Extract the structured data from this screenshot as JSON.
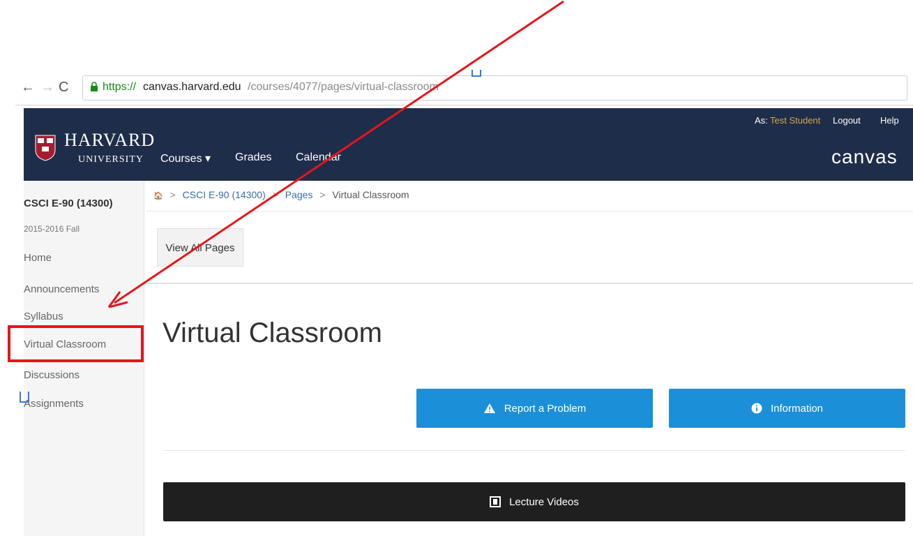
{
  "browser": {
    "url_scheme": "https://",
    "url_host": "canvas.harvard.edu",
    "url_path": "/courses/4077/pages/virtual-classroom",
    "back_glyph": "←",
    "forward_glyph": "→",
    "reload_glyph": "C",
    "icons": [
      "back-arrow-icon",
      "forward-arrow-icon",
      "reload-icon",
      "lock-icon"
    ]
  },
  "header": {
    "logo_line1": "HARVARD",
    "logo_line2": "UNIVERSITY",
    "nav": {
      "courses": "Courses ▾",
      "grades": "Grades",
      "calendar": "Calendar"
    },
    "user_prefix": "As:",
    "user_name": "Test Student",
    "logout": "Logout",
    "help": "Help",
    "brand": "canvas",
    "background": "#1e2d4a",
    "user_color": "#d6a64a"
  },
  "sidebar": {
    "course_code": "CSCI E-90 (14300)",
    "term": "2015-2016 Fall",
    "items": [
      {
        "label": "Home"
      },
      {
        "label": "Announcements"
      },
      {
        "label": "Syllabus"
      },
      {
        "label": "Virtual Classroom"
      },
      {
        "label": "Discussions"
      },
      {
        "label": "Assignments"
      }
    ]
  },
  "breadcrumb": {
    "home_glyph": "🏠",
    "separator": ">",
    "course": "CSCI E-90 (14300)",
    "pages": "Pages",
    "current": "Virtual Classroom"
  },
  "toolbar": {
    "view_all_pages": "View All Pages"
  },
  "main": {
    "title": "Virtual Classroom",
    "report_problem": "Report a Problem",
    "information": "Information",
    "lecture_videos": "Lecture Videos",
    "button_color": "#1c8fd9",
    "dark_button_color": "#1f1f1f"
  },
  "annotation": {
    "color": "#e8141b",
    "highlighted_item": "Virtual Classroom"
  }
}
